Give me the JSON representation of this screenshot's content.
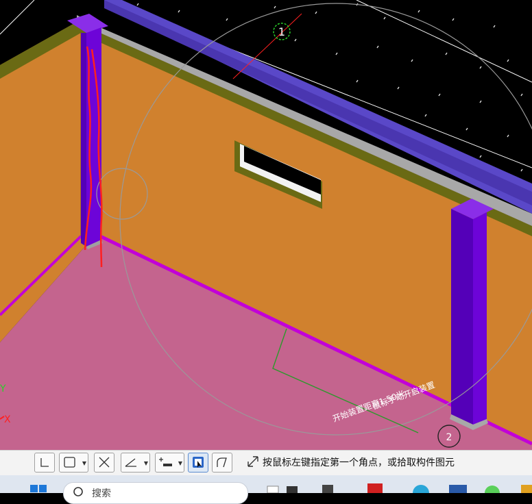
{
  "viewport": {
    "axis_number_label": "1",
    "axis_y_label": "Y",
    "axis_x_label": "X",
    "annotation_line1": "鼠标手动开启装置",
    "annotation_line2": "开始装置距离1.50米",
    "bottom_marker": "2",
    "colors": {
      "wall": "#d0812e",
      "floor": "#c4648e",
      "column": "#6d04d8",
      "beam": "#5a48c8",
      "edge_line": "#c200d8",
      "cursor_circle": "#9a9a9a",
      "markup_red": "#ff2020"
    }
  },
  "toolbar": {
    "buttons": [
      {
        "name": "line-tool-button",
        "icon": "line-icon"
      },
      {
        "name": "rectangle-tool-button",
        "icon": "rectangle-icon",
        "dropdown": true,
        "active": false
      },
      {
        "name": "cross-tool-button",
        "icon": "cross-icon"
      },
      {
        "name": "angle-tool-button",
        "icon": "angle-icon",
        "dropdown": true
      },
      {
        "name": "point-tool-button",
        "icon": "point-icon",
        "dropdown": true
      },
      {
        "name": "select-tool-button",
        "icon": "select-icon",
        "active": true
      },
      {
        "name": "arc-tool-button",
        "icon": "arc-icon"
      }
    ],
    "status_text": "按鼠标左键指定第一个角点，或拾取构件图元"
  },
  "taskbar": {
    "search_placeholder": "搜索"
  }
}
